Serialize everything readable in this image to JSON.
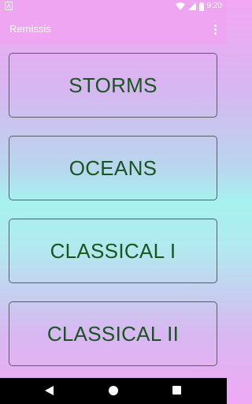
{
  "status_bar": {
    "time": "9:20",
    "icons": [
      "notification-a-icon",
      "wifi-icon",
      "signal-icon",
      "battery-icon"
    ]
  },
  "app_bar": {
    "title": "Remissis",
    "menu_icon": "overflow-menu-icon"
  },
  "buttons": [
    {
      "label": "STORMS"
    },
    {
      "label": "OCEANS"
    },
    {
      "label": "CLASSICAL I"
    },
    {
      "label": "CLASSICAL II"
    }
  ],
  "nav_bar": {
    "icons": [
      "back-icon",
      "home-icon",
      "recents-icon"
    ]
  },
  "colors": {
    "app_bar": "#f0a5f3",
    "button_text": "#17571f",
    "button_border": "#5b5b6b"
  }
}
